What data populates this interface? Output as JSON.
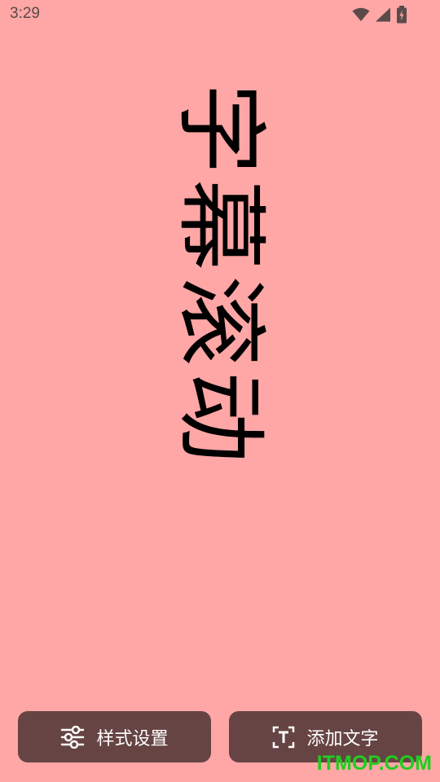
{
  "status_bar": {
    "time": "3:29",
    "icons": [
      "wifi-icon",
      "cell-signal-icon",
      "battery-charging-icon"
    ]
  },
  "marquee": {
    "text": "字幕滚动",
    "text_color": "#000000",
    "background_color": "#ffa6a6"
  },
  "bottom_bar": {
    "style_button": {
      "label": "样式设置",
      "icon": "sliders-icon"
    },
    "add_text_button": {
      "label": "添加文字",
      "icon": "text-frame-icon"
    },
    "button_color": "#674444"
  },
  "watermark": {
    "text": "ITMOP.COM",
    "color": "#1fce1f"
  }
}
